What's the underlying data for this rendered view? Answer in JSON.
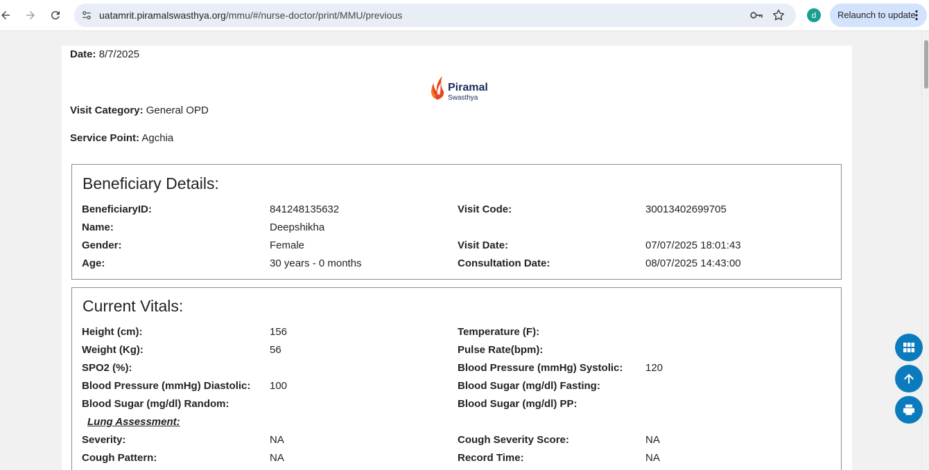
{
  "browser": {
    "url_host": "uatamrit.piramalswasthya.org",
    "url_path": "/mmu/#/nurse-doctor/print/MMU/previous",
    "avatar_letter": "d",
    "relaunch_label": "Relaunch to update"
  },
  "header": {
    "date_label": "Date:",
    "date_value": "8/7/2025",
    "visit_category_label": "Visit Category:",
    "visit_category_value": "General OPD",
    "service_point_label": "Service Point:",
    "service_point_value": "Agchia",
    "logo_brand": "Piramal",
    "logo_sub": "Swasthya"
  },
  "beneficiary": {
    "title": "Beneficiary Details:",
    "left": [
      {
        "label": "BeneficiaryID:",
        "value": "841248135632"
      },
      {
        "label": "Name:",
        "value": "Deepshikha"
      },
      {
        "label": "Gender:",
        "value": "Female"
      },
      {
        "label": "Age:",
        "value": "30 years - 0 months"
      }
    ],
    "right": [
      {
        "label": "Visit Code:",
        "value": "30013402699705"
      },
      {
        "label": "",
        "value": ""
      },
      {
        "label": "Visit Date:",
        "value": "07/07/2025 18:01:43"
      },
      {
        "label": "Consultation Date:",
        "value": "08/07/2025 14:43:00"
      }
    ]
  },
  "vitals": {
    "title": "Current Vitals:",
    "left": [
      {
        "label": "Height (cm):",
        "value": "156"
      },
      {
        "label": "Weight (Kg):",
        "value": "56"
      },
      {
        "label": "SPO2 (%):",
        "value": ""
      },
      {
        "label": "Blood Pressure (mmHg) Diastolic:",
        "value": "100"
      },
      {
        "label": "Blood Sugar (mg/dl) Random:",
        "value": ""
      }
    ],
    "right": [
      {
        "label": "Temperature (F):",
        "value": ""
      },
      {
        "label": "Pulse Rate(bpm):",
        "value": ""
      },
      {
        "label": "Blood Pressure (mmHg) Systolic:",
        "value": "120"
      },
      {
        "label": "Blood Sugar (mg/dl) Fasting:",
        "value": ""
      },
      {
        "label": "Blood Sugar (mg/dl) PP:",
        "value": ""
      }
    ],
    "lung_heading": "Lung Assessment:",
    "lung_left": [
      {
        "label": "Severity:",
        "value": "NA"
      },
      {
        "label": "Cough Pattern:",
        "value": "NA"
      }
    ],
    "lung_right": [
      {
        "label": "Cough Severity Score:",
        "value": "NA"
      },
      {
        "label": "Record Time:",
        "value": "NA"
      }
    ]
  },
  "colors": {
    "fab": "#0b7bbd",
    "logo_orange": "#e8471e",
    "logo_navy": "#1d2a5b"
  },
  "icons": [
    "back-arrow-icon",
    "forward-arrow-icon",
    "reload-icon",
    "site-settings-icon",
    "key-icon",
    "star-icon",
    "kebab-menu-icon",
    "grid-icon",
    "arrow-up-icon",
    "printer-icon"
  ]
}
